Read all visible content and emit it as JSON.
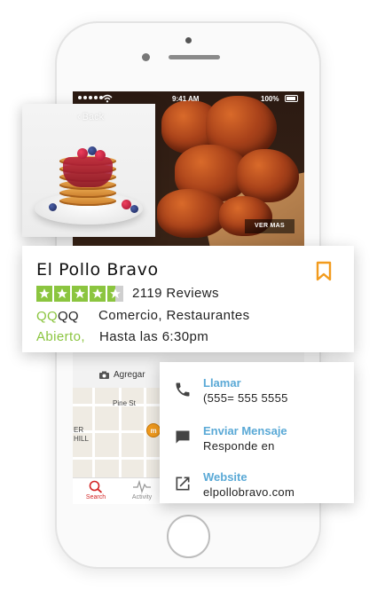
{
  "status_bar": {
    "time": "9:41 AM",
    "battery": "100%"
  },
  "hero": {
    "more_button": "VER MAS"
  },
  "food_card": {
    "back_label": "Back"
  },
  "business": {
    "name": "El Pollo Bravo",
    "rating": 4.5,
    "reviews": "2119 Reviews",
    "price_active": "QQ",
    "price_inactive": "QQ",
    "category": "Comercio, Restaurantes",
    "open_status": "Abierto,",
    "hours": "Hasta las 6:30pm"
  },
  "actions": {
    "add_photo": "Agregar"
  },
  "map": {
    "street_label": "Pine St",
    "district_top": "ER",
    "district_bottom": "HILL",
    "pin_label": "m"
  },
  "tabbar": {
    "items": [
      {
        "label": "Search",
        "icon": "search-icon"
      },
      {
        "label": "Activity",
        "icon": "activity-icon"
      }
    ]
  },
  "contact": {
    "call_title": "Llamar",
    "call_sub": "(555= 555 5555",
    "message_title": "Enviar Mensaje",
    "message_sub": "Responde en",
    "website_title": "Website",
    "website_sub": "elpollobravo.com"
  },
  "colors": {
    "accent_green": "#8bc53f",
    "link_blue": "#5aa9d6",
    "bookmark_orange": "#f29b1d",
    "tab_red": "#d32323"
  }
}
